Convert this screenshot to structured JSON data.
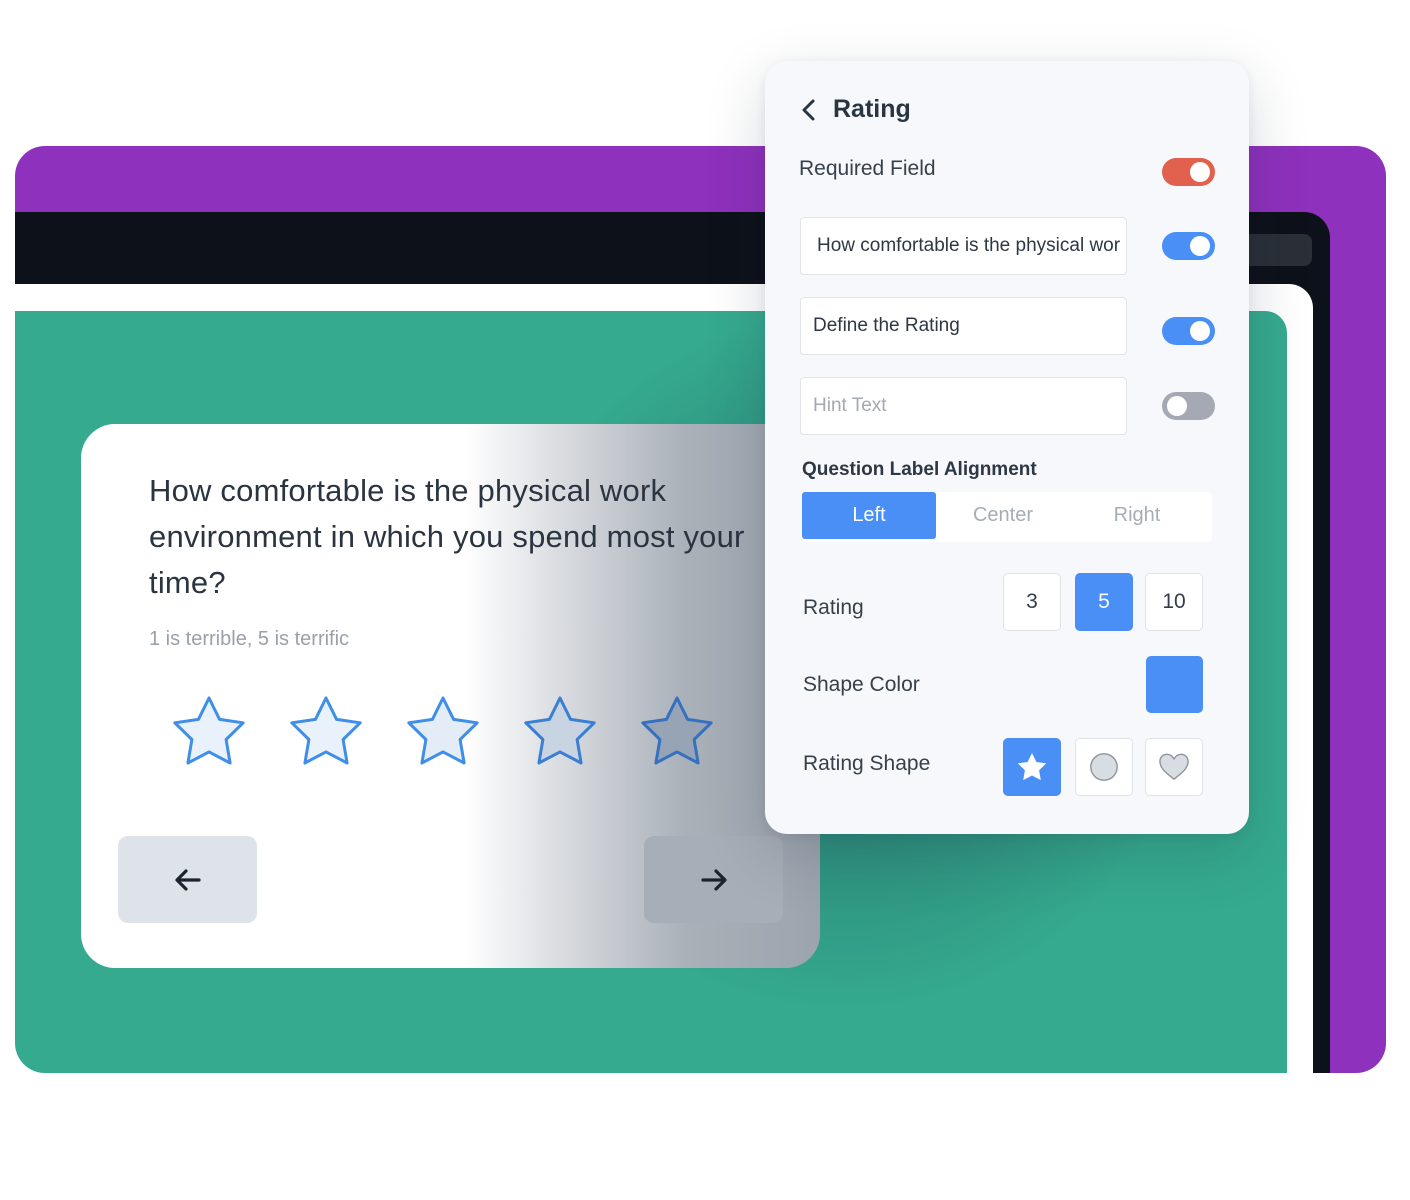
{
  "question": {
    "text": "How comfortable is the physical work environment in which you spend most your time?",
    "hint": "1 is terrible, 5 is terrific",
    "star_count": 5,
    "star_icon": "star-icon",
    "prev_icon": "arrow-left-icon",
    "next_icon": "arrow-right-icon"
  },
  "panel": {
    "title": "Rating",
    "back_icon": "chevron-left-icon",
    "required_label": "Required Field",
    "required_on": true,
    "fields": [
      {
        "value": "How comfortable is the physical wor",
        "placeholder": false,
        "toggle_on": true
      },
      {
        "value": "Define the Rating",
        "placeholder": false,
        "toggle_on": true
      },
      {
        "value": "Hint Text",
        "placeholder": true,
        "toggle_on": false
      }
    ],
    "alignment": {
      "label": "Question Label Alignment",
      "options": [
        "Left",
        "Center",
        "Right"
      ],
      "selected": "Left"
    },
    "rating": {
      "label": "Rating",
      "options": [
        "3",
        "5",
        "10"
      ],
      "selected": "5"
    },
    "shape_color": {
      "label": "Shape Color",
      "value": "#4a8ff5"
    },
    "rating_shape": {
      "label": "Rating Shape",
      "options": [
        "star-icon",
        "circle-icon",
        "heart-icon"
      ],
      "selected": "star-icon"
    }
  },
  "colors": {
    "accent": "#4a8ff5",
    "required_toggle": "#e2614e",
    "toggle_off": "#a5a9b3",
    "frame_purple": "#8e31bd",
    "canvas_green": "#35aa8e"
  }
}
